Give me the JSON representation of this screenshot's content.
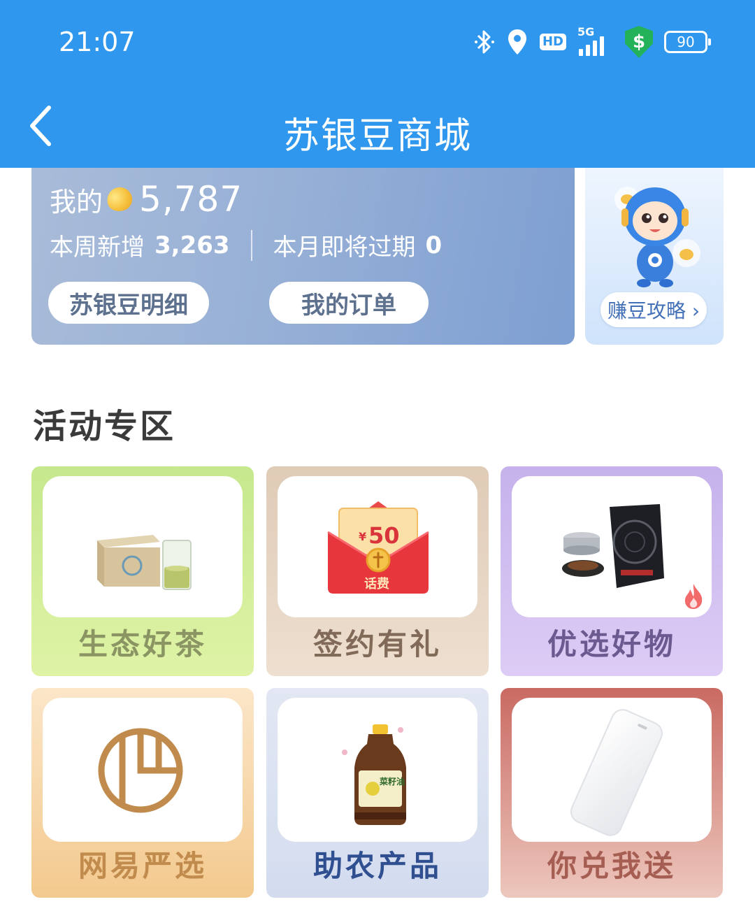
{
  "status_bar": {
    "time": "21:07",
    "hd": "HD",
    "network": "5G",
    "security_symbol": "$",
    "battery": "90",
    "icons": [
      "bluetooth-icon",
      "location-icon",
      "hd-icon",
      "signal-5g-icon",
      "security-shield-icon",
      "battery-icon"
    ]
  },
  "header": {
    "title": "苏银豆商城",
    "back_icon": "chevron-left-icon"
  },
  "bean_card": {
    "mine_label": "我的",
    "bean_icon": "gold-bean-icon",
    "total": "5,787",
    "weekly_label": "本周新增",
    "weekly_value": "3,263",
    "expiring_label": "本月即将过期",
    "expiring_value": "0",
    "detail_button": "苏银豆明细",
    "orders_button": "我的订单"
  },
  "guide_card": {
    "mascot": "robot-mascot-image",
    "button": "赚豆攻略 ›"
  },
  "activity": {
    "title": "活动专区",
    "tiles": [
      {
        "label": "生态好茶",
        "image": "tea-box-and-glass-image"
      },
      {
        "label": "签约有礼",
        "image": "red-envelope-image",
        "voucher_amount": "50",
        "currency": "¥",
        "voucher_tag": "话费"
      },
      {
        "label": "优选好物",
        "image": "induction-cooker-image",
        "badge": "flame-icon"
      },
      {
        "label": "网易严选",
        "image": "netease-yanxuan-logo"
      },
      {
        "label": "助农产品",
        "image": "oil-bottle-image",
        "bottle_text": "菜籽油"
      },
      {
        "label": "你兑我送",
        "image": "power-bank-image"
      }
    ]
  },
  "colors": {
    "header_blue": "#2f97ee",
    "card_blue": "#8fa9d4",
    "title_text": "#3a3a3a"
  }
}
